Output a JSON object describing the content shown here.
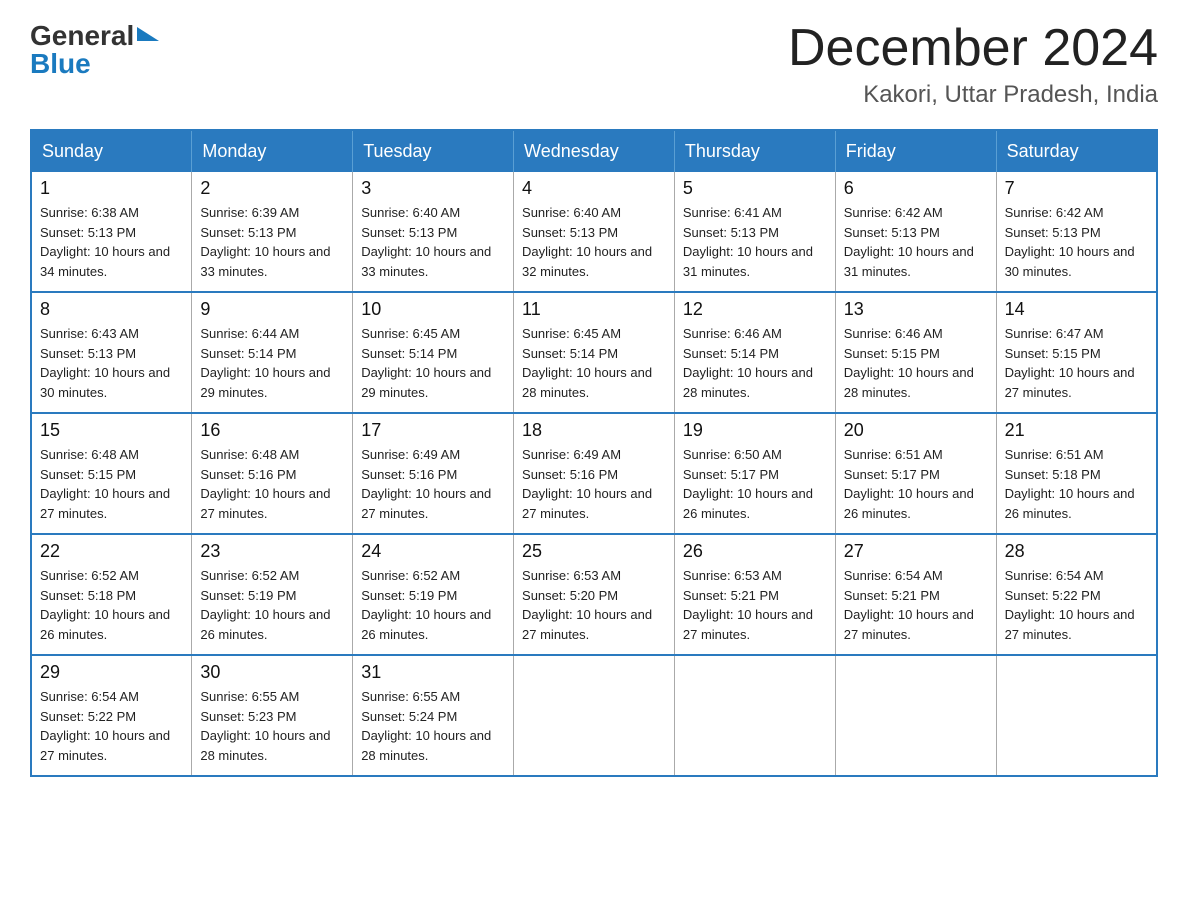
{
  "header": {
    "logo_general": "General",
    "logo_blue": "Blue",
    "month_title": "December 2024",
    "location": "Kakori, Uttar Pradesh, India"
  },
  "calendar": {
    "days_of_week": [
      "Sunday",
      "Monday",
      "Tuesday",
      "Wednesday",
      "Thursday",
      "Friday",
      "Saturday"
    ],
    "weeks": [
      [
        {
          "day": "1",
          "sunrise": "6:38 AM",
          "sunset": "5:13 PM",
          "daylight": "10 hours and 34 minutes."
        },
        {
          "day": "2",
          "sunrise": "6:39 AM",
          "sunset": "5:13 PM",
          "daylight": "10 hours and 33 minutes."
        },
        {
          "day": "3",
          "sunrise": "6:40 AM",
          "sunset": "5:13 PM",
          "daylight": "10 hours and 33 minutes."
        },
        {
          "day": "4",
          "sunrise": "6:40 AM",
          "sunset": "5:13 PM",
          "daylight": "10 hours and 32 minutes."
        },
        {
          "day": "5",
          "sunrise": "6:41 AM",
          "sunset": "5:13 PM",
          "daylight": "10 hours and 31 minutes."
        },
        {
          "day": "6",
          "sunrise": "6:42 AM",
          "sunset": "5:13 PM",
          "daylight": "10 hours and 31 minutes."
        },
        {
          "day": "7",
          "sunrise": "6:42 AM",
          "sunset": "5:13 PM",
          "daylight": "10 hours and 30 minutes."
        }
      ],
      [
        {
          "day": "8",
          "sunrise": "6:43 AM",
          "sunset": "5:13 PM",
          "daylight": "10 hours and 30 minutes."
        },
        {
          "day": "9",
          "sunrise": "6:44 AM",
          "sunset": "5:14 PM",
          "daylight": "10 hours and 29 minutes."
        },
        {
          "day": "10",
          "sunrise": "6:45 AM",
          "sunset": "5:14 PM",
          "daylight": "10 hours and 29 minutes."
        },
        {
          "day": "11",
          "sunrise": "6:45 AM",
          "sunset": "5:14 PM",
          "daylight": "10 hours and 28 minutes."
        },
        {
          "day": "12",
          "sunrise": "6:46 AM",
          "sunset": "5:14 PM",
          "daylight": "10 hours and 28 minutes."
        },
        {
          "day": "13",
          "sunrise": "6:46 AM",
          "sunset": "5:15 PM",
          "daylight": "10 hours and 28 minutes."
        },
        {
          "day": "14",
          "sunrise": "6:47 AM",
          "sunset": "5:15 PM",
          "daylight": "10 hours and 27 minutes."
        }
      ],
      [
        {
          "day": "15",
          "sunrise": "6:48 AM",
          "sunset": "5:15 PM",
          "daylight": "10 hours and 27 minutes."
        },
        {
          "day": "16",
          "sunrise": "6:48 AM",
          "sunset": "5:16 PM",
          "daylight": "10 hours and 27 minutes."
        },
        {
          "day": "17",
          "sunrise": "6:49 AM",
          "sunset": "5:16 PM",
          "daylight": "10 hours and 27 minutes."
        },
        {
          "day": "18",
          "sunrise": "6:49 AM",
          "sunset": "5:16 PM",
          "daylight": "10 hours and 27 minutes."
        },
        {
          "day": "19",
          "sunrise": "6:50 AM",
          "sunset": "5:17 PM",
          "daylight": "10 hours and 26 minutes."
        },
        {
          "day": "20",
          "sunrise": "6:51 AM",
          "sunset": "5:17 PM",
          "daylight": "10 hours and 26 minutes."
        },
        {
          "day": "21",
          "sunrise": "6:51 AM",
          "sunset": "5:18 PM",
          "daylight": "10 hours and 26 minutes."
        }
      ],
      [
        {
          "day": "22",
          "sunrise": "6:52 AM",
          "sunset": "5:18 PM",
          "daylight": "10 hours and 26 minutes."
        },
        {
          "day": "23",
          "sunrise": "6:52 AM",
          "sunset": "5:19 PM",
          "daylight": "10 hours and 26 minutes."
        },
        {
          "day": "24",
          "sunrise": "6:52 AM",
          "sunset": "5:19 PM",
          "daylight": "10 hours and 26 minutes."
        },
        {
          "day": "25",
          "sunrise": "6:53 AM",
          "sunset": "5:20 PM",
          "daylight": "10 hours and 27 minutes."
        },
        {
          "day": "26",
          "sunrise": "6:53 AM",
          "sunset": "5:21 PM",
          "daylight": "10 hours and 27 minutes."
        },
        {
          "day": "27",
          "sunrise": "6:54 AM",
          "sunset": "5:21 PM",
          "daylight": "10 hours and 27 minutes."
        },
        {
          "day": "28",
          "sunrise": "6:54 AM",
          "sunset": "5:22 PM",
          "daylight": "10 hours and 27 minutes."
        }
      ],
      [
        {
          "day": "29",
          "sunrise": "6:54 AM",
          "sunset": "5:22 PM",
          "daylight": "10 hours and 27 minutes."
        },
        {
          "day": "30",
          "sunrise": "6:55 AM",
          "sunset": "5:23 PM",
          "daylight": "10 hours and 28 minutes."
        },
        {
          "day": "31",
          "sunrise": "6:55 AM",
          "sunset": "5:24 PM",
          "daylight": "10 hours and 28 minutes."
        },
        null,
        null,
        null,
        null
      ]
    ]
  }
}
